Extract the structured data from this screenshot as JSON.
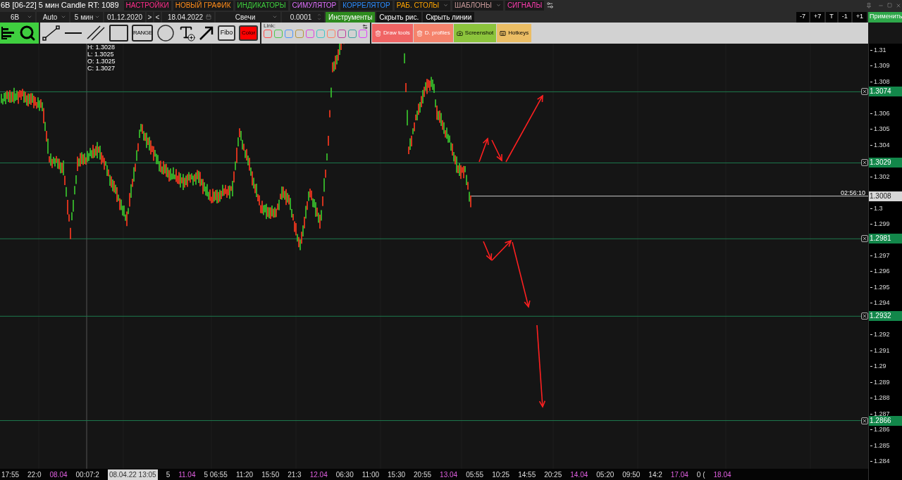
{
  "title_bar": {
    "title": "6B [06-22] 5 мин Candle RT: 1089",
    "menu": [
      {
        "label": "НАСТРОЙКИ",
        "color": "#ff2d8a",
        "dropdown": false
      },
      {
        "label": "НОВЫЙ ГРАФИК",
        "color": "#ff8c1a",
        "dropdown": false
      },
      {
        "label": "ИНДИКАТОРЫ",
        "color": "#3ecf3e",
        "dropdown": false
      },
      {
        "label": "СИМУЛЯТОР",
        "color": "#e070ff",
        "dropdown": false
      },
      {
        "label": "КОРРЕЛЯТОР",
        "color": "#2a8cff",
        "dropdown": false
      },
      {
        "label": "РАБ. СТОЛЫ",
        "color": "#ffa500",
        "dropdown": true
      },
      {
        "label": "ШАБЛОНЫ",
        "color": "#c89a9a",
        "dropdown": true
      },
      {
        "label": "СИГНАЛЫ",
        "color": "#ff3db0",
        "dropdown": false
      }
    ]
  },
  "toolbar": {
    "items": [
      {
        "kind": "select",
        "value": "6B"
      },
      {
        "kind": "select",
        "value": "Auto"
      },
      {
        "kind": "select",
        "value": "5 мин"
      },
      {
        "kind": "date",
        "value": "01.12.2020"
      },
      {
        "kind": "button",
        "label": ">"
      },
      {
        "kind": "button",
        "label": "<"
      },
      {
        "kind": "date",
        "value": "18.04.2022"
      },
      {
        "kind": "select",
        "value": "Свечи"
      },
      {
        "kind": "spin",
        "value": "0.0001"
      },
      {
        "kind": "toggle",
        "label": "Инструменты",
        "on": true
      },
      {
        "kind": "toggle",
        "label": "Скрыть рис.",
        "on": false
      },
      {
        "kind": "toggle",
        "label": "Скрыть линии",
        "on": false
      }
    ],
    "right_buttons": [
      {
        "label": "-7",
        "primary": false
      },
      {
        "label": "+7",
        "primary": false
      },
      {
        "label": "T",
        "primary": false
      },
      {
        "label": "-1",
        "primary": false
      },
      {
        "label": "+1",
        "primary": false
      },
      {
        "label": "Применить",
        "primary": true
      }
    ]
  },
  "draw_tools": {
    "range_label": "RANGE",
    "fibo_label": "Fibo",
    "color_label": "Color",
    "link_label": "Link:",
    "link_colors": [
      {
        "color": "#ff4a4a"
      },
      {
        "color": "#4cc94c"
      },
      {
        "color": "#4a96ff"
      },
      {
        "color": "#b8963c"
      },
      {
        "color": "#e040e0"
      },
      {
        "color": "#3fc6c6"
      },
      {
        "color": "#ff8060"
      },
      {
        "color": "#c03c9c"
      },
      {
        "color": "#3fa0a0"
      },
      {
        "color": "#e040ff"
      }
    ],
    "actions": [
      {
        "label": "Draw tools",
        "color": "#f06464"
      },
      {
        "label": "D. profiles",
        "color": "#f5836c"
      },
      {
        "label": "Screenshot",
        "color": "#8cc43c"
      },
      {
        "label": "Hotkeys",
        "color": "#ebbd64"
      }
    ]
  },
  "ohlc": [
    "H: 1.3028",
    "L: 1.3025",
    "O: 1.3025",
    "C: 1.3027"
  ],
  "price_axis": [
    "1.31",
    "1.309",
    "1.308",
    "1.306",
    "1.305",
    "1.304",
    "1.302",
    "1.3",
    "1.299",
    "1.297",
    "1.296",
    "1.295",
    "1.294",
    "1.292",
    "1.291",
    "1.29",
    "1.289",
    "1.288",
    "1.287",
    "1.286",
    "1.285",
    "1.284"
  ],
  "levels": [
    {
      "price": "1.3074"
    },
    {
      "price": "1.3029"
    },
    {
      "price": "1.2981"
    },
    {
      "price": "1.2932"
    },
    {
      "price": "1.2866"
    }
  ],
  "last_price": {
    "time": "02:56:10",
    "price": "1.3008"
  },
  "time_axis": [
    {
      "kind": "time",
      "label": "17:55"
    },
    {
      "kind": "time",
      "label": "22:0"
    },
    {
      "kind": "date",
      "label": "08.04"
    },
    {
      "kind": "time",
      "label": "00:07:2"
    },
    {
      "kind": "cursor",
      "label": "08.04.22 13:05"
    },
    {
      "kind": "time",
      "label": "5"
    },
    {
      "kind": "date",
      "label": "11.04"
    },
    {
      "kind": "time",
      "label": "5 06:55"
    },
    {
      "kind": "time",
      "label": "11:20"
    },
    {
      "kind": "time",
      "label": "15:50"
    },
    {
      "kind": "time",
      "label": "21:3"
    },
    {
      "kind": "date",
      "label": "12.04"
    },
    {
      "kind": "time",
      "label": "06:30"
    },
    {
      "kind": "time",
      "label": "11:00"
    },
    {
      "kind": "time",
      "label": "15:30"
    },
    {
      "kind": "time",
      "label": "20:55"
    },
    {
      "kind": "date",
      "label": "13.04"
    },
    {
      "kind": "time",
      "label": "05:55"
    },
    {
      "kind": "time",
      "label": "10:25"
    },
    {
      "kind": "time",
      "label": "14:55"
    },
    {
      "kind": "time",
      "label": "20:25"
    },
    {
      "kind": "date",
      "label": "14.04"
    },
    {
      "kind": "time",
      "label": "05:20"
    },
    {
      "kind": "time",
      "label": "09:50"
    },
    {
      "kind": "time",
      "label": "14:2"
    },
    {
      "kind": "date",
      "label": "17.04"
    },
    {
      "kind": "time",
      "label": "0 ("
    },
    {
      "kind": "date",
      "label": "18.04"
    }
  ]
}
